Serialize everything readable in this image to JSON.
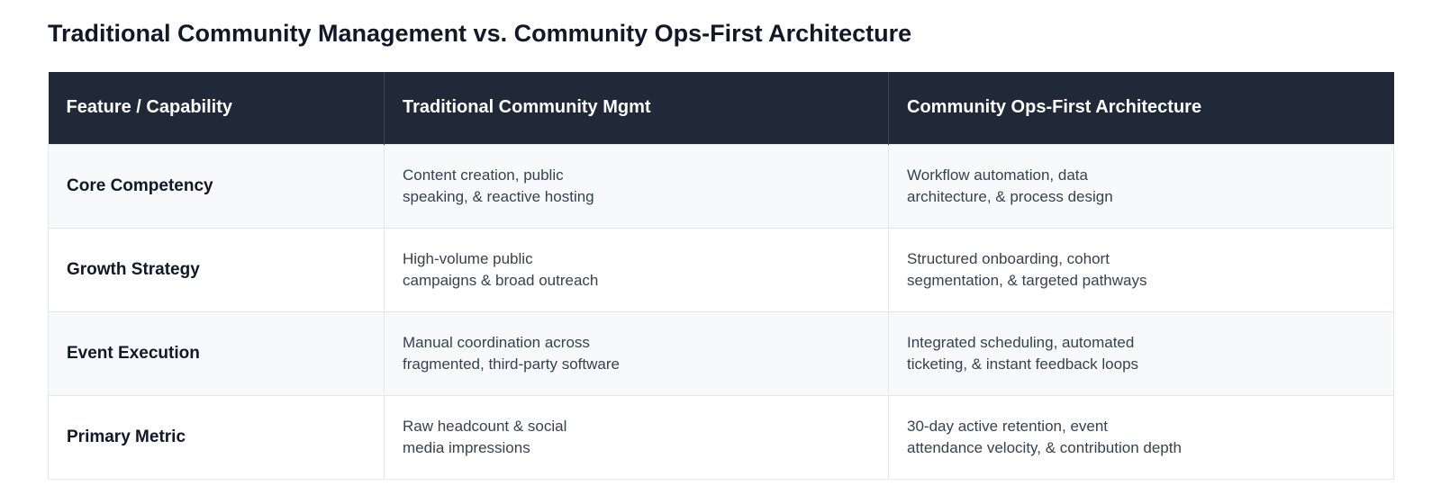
{
  "title": "Traditional Community Management vs. Community Ops-First Architecture",
  "table": {
    "headers": [
      "Feature / Capability",
      "Traditional Community Mgmt",
      "Community Ops-First Architecture"
    ],
    "rows": [
      {
        "feature": "Core Competency",
        "traditional": [
          "Content creation, public",
          "speaking, & reactive hosting"
        ],
        "opsfirst": [
          "Workflow automation, data",
          "architecture, & process design"
        ]
      },
      {
        "feature": "Growth Strategy",
        "traditional": [
          "High-volume public",
          "campaigns & broad outreach"
        ],
        "opsfirst": [
          "Structured onboarding, cohort",
          "segmentation, & targeted pathways"
        ]
      },
      {
        "feature": "Event Execution",
        "traditional": [
          "Manual coordination across",
          "fragmented, third-party software"
        ],
        "opsfirst": [
          "Integrated scheduling, automated",
          "ticketing, & instant feedback loops"
        ]
      },
      {
        "feature": "Primary Metric",
        "traditional": [
          "Raw headcount & social",
          "media impressions"
        ],
        "opsfirst": [
          "30-day active retention, event",
          "attendance velocity, & contribution depth"
        ]
      }
    ]
  },
  "colors": {
    "header_bg": "#1f2937",
    "header_text": "#ffffff",
    "row_alt_bg": "#f8f9fb",
    "border": "#e5e7eb",
    "body_text": "#374151",
    "title_text": "#111827"
  }
}
